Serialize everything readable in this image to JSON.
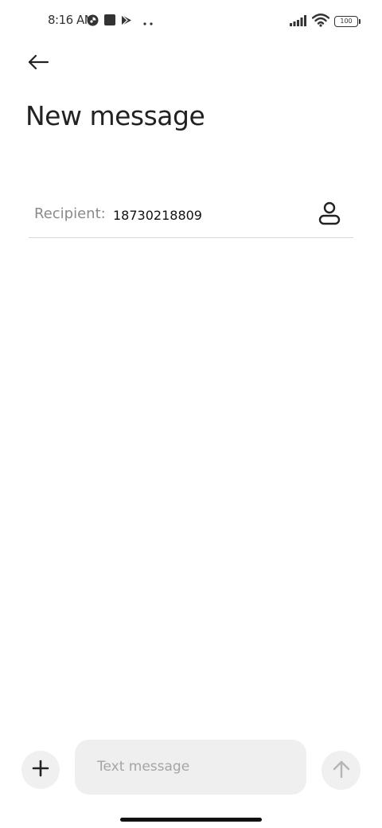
{
  "status_bar": {
    "time": "8:16 AM",
    "left_icons": [
      "app-notification-icon",
      "stop-square-icon",
      "play-store-icon",
      "more-dots-icon"
    ],
    "battery_level": "100",
    "right_icons": [
      "signal-icon",
      "wifi-icon",
      "battery-icon"
    ]
  },
  "header": {
    "back_icon": "back-arrow-icon",
    "title": "New message"
  },
  "recipient": {
    "label": "Recipient:",
    "value": "18730218809",
    "contact_icon": "person-icon"
  },
  "composer": {
    "attach_icon": "plus-icon",
    "placeholder": "Text message",
    "send_icon": "arrow-up-icon"
  },
  "colors": {
    "background": "#ffffff",
    "title_text": "#222222",
    "label_text": "#8a8a8a",
    "field_background": "#efefef",
    "button_background": "#f0f0f0",
    "divider": "#d8d8d8",
    "send_icon_disabled": "#b5b5b5"
  }
}
